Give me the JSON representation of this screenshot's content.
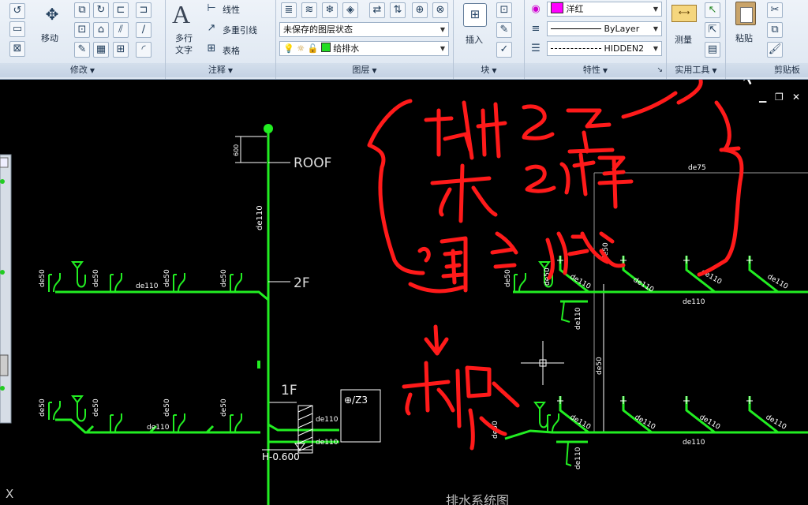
{
  "ribbon": {
    "modify": {
      "title": "修改",
      "move_label": "移动"
    },
    "annotation": {
      "title": "注释",
      "mtext_label": "多行",
      "mtext_label2": "文字",
      "linear_label": "线性",
      "mleader_label": "多重引线",
      "table_label": "表格"
    },
    "layers": {
      "title": "图层",
      "state_value": "未保存的图层状态",
      "layer_value": "给排水"
    },
    "block": {
      "title": "块",
      "insert_label": "插入"
    },
    "properties": {
      "title": "特性",
      "color_value": "洋红",
      "linetype_value": "ByLayer",
      "lineweight_value": "HIDDEN2"
    },
    "utilities": {
      "title": "实用工具",
      "measure_label": "测量"
    },
    "clipboard": {
      "title": "剪贴板",
      "paste_label": "粘贴"
    }
  },
  "window": {
    "minimize": "▁",
    "restore": "❐",
    "close": "✕",
    "x_mark": "X"
  },
  "drawing": {
    "left": {
      "roof": "ROOF",
      "f2": "2F",
      "f1": "1F",
      "dim_600": "600",
      "stack_de110": "de110",
      "h_level": "H-0.600",
      "pipe_tag": "⊕/Z3",
      "de110_a": "de110",
      "de110_b": "de110",
      "f2_branches": [
        "de50",
        "de50",
        "de50",
        "de50"
      ],
      "f2_main": "de110",
      "f1_branches": [
        "de50",
        "de50",
        "de50",
        "de50"
      ],
      "f1_main": "de110"
    },
    "right": {
      "de75": "de75",
      "de50_vert": "de50",
      "de50_mid": "de50",
      "de110_vert_top": "de110",
      "de110_vert_bot": "de110",
      "top_branches": [
        "de50",
        "de50",
        "de110",
        "de110",
        "de110",
        "de110"
      ],
      "top_main": "de110",
      "bot_branches": [
        "de50",
        "de110",
        "de110",
        "de110",
        "de110"
      ],
      "bot_main": "de110",
      "title": "排水系统图"
    }
  },
  "colors": {
    "pipe": "#22ee22",
    "annotation": "#ff1a1a",
    "white_line": "#ffffff",
    "grey_line": "#9a9a9a",
    "magenta": "#ff00ff"
  }
}
